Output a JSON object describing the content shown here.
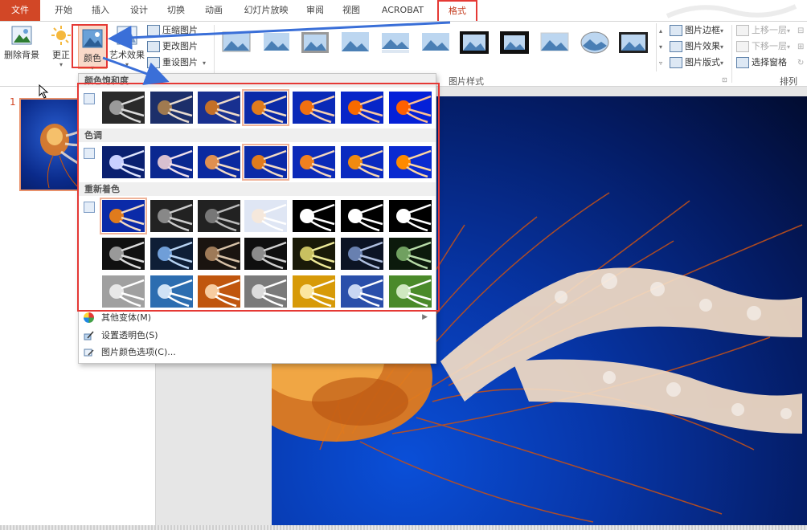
{
  "tabs": [
    {
      "label": "文件"
    },
    {
      "label": "开始"
    },
    {
      "label": "插入"
    },
    {
      "label": "设计"
    },
    {
      "label": "切换"
    },
    {
      "label": "动画"
    },
    {
      "label": "幻灯片放映"
    },
    {
      "label": "审阅"
    },
    {
      "label": "视图"
    },
    {
      "label": "ACROBAT"
    },
    {
      "label": "格式"
    }
  ],
  "ribbon": {
    "remove_bg": "删除背景",
    "corrections": "更正",
    "color": "颜色",
    "artistic": "艺术效果",
    "compress": "压缩图片",
    "change": "更改图片",
    "reset": "重设图片",
    "picture_styles_group": "图片样式",
    "border": "图片边框",
    "effects": "图片效果",
    "layout": "图片版式",
    "bring_forward": "上移一层",
    "send_backward": "下移一层",
    "selection_pane": "选择窗格",
    "arrange_group": "排列"
  },
  "slide_panel": {
    "slide_number": "1"
  },
  "color_menu": {
    "saturation_header": "颜色饱和度",
    "tone_header": "色调",
    "recolor_header": "重新着色",
    "more_variations": "其他变体(M)",
    "set_transparent": "设置透明色(S)",
    "color_options": "图片颜色选项(C)..."
  },
  "colors": {
    "accent": "#d24726",
    "annotation": "#e53935",
    "arrow": "#3a6fd8"
  }
}
